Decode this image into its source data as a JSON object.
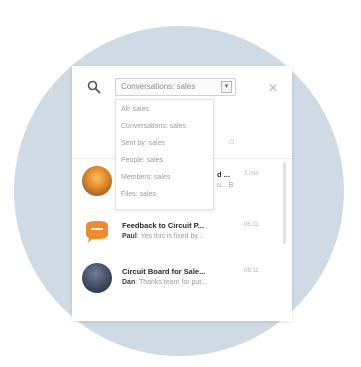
{
  "colors": {
    "background": "#ffffff",
    "circle": "#cfdbe4",
    "panel": "#ffffff",
    "title_text": "#2a2a2a",
    "muted_text": "#9c9c9c",
    "accent_orange": "#f08a2a"
  },
  "search": {
    "icon": "search-icon",
    "scope_label": "Conversations: sales",
    "close_icon": "close-icon",
    "close_glyph": "✕"
  },
  "dropdown": {
    "options": [
      "All: sales",
      "Conversations: sales",
      "Sent by: sales",
      "People: sales",
      "Members: sales",
      "Files: sales"
    ]
  },
  "conversations": [
    {
      "title": "d ...",
      "time": "3 min",
      "preview_sender": "",
      "preview_text": "u... B"
    },
    {
      "title": "Feedback to Circuit P...",
      "time": "06:11",
      "preview_sender": "Paul",
      "preview_text": "Yes this is fixed by..."
    },
    {
      "title": "Circuit Board for Sale...",
      "time": "06:11",
      "preview_sender": "Dan",
      "preview_text": "Thanks team for put..."
    }
  ]
}
